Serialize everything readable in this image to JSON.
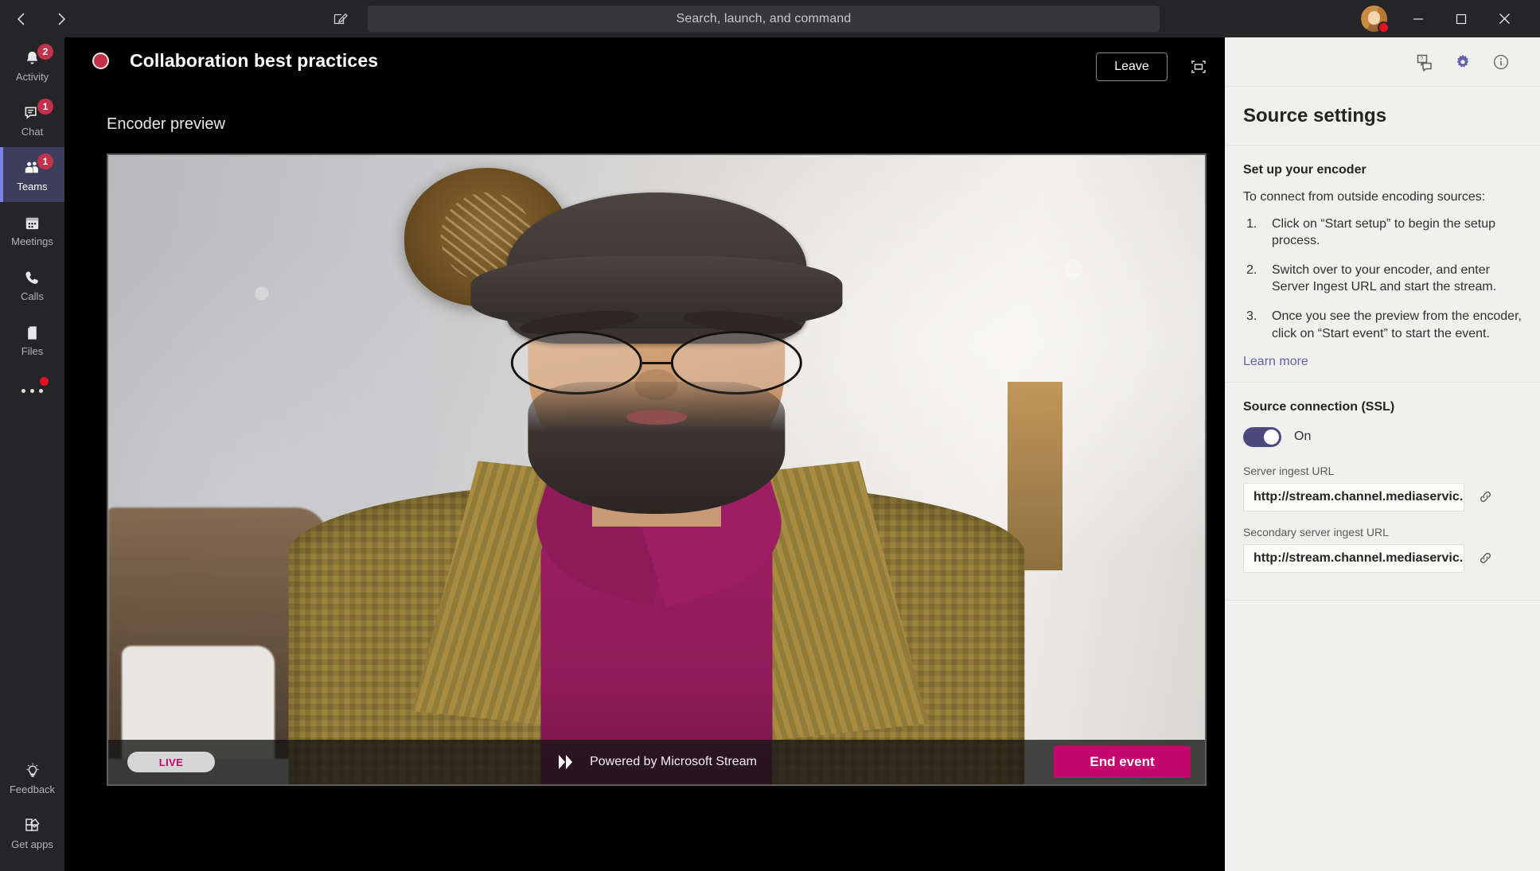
{
  "titlebar": {
    "back_icon": "chevron-left-icon",
    "forward_icon": "chevron-right-icon",
    "compose_icon": "compose-new-chat-icon",
    "search_placeholder": "Search, launch, and command",
    "minimize_label": "—",
    "maximize_label": "□",
    "close_label": "✕"
  },
  "rail": {
    "items": [
      {
        "label": "Activity",
        "icon": "bell-icon",
        "badge": "2",
        "active": false
      },
      {
        "label": "Chat",
        "icon": "chat-icon",
        "badge": "1",
        "active": false
      },
      {
        "label": "Teams",
        "icon": "teams-icon",
        "badge": "1",
        "active": true
      },
      {
        "label": "Meetings",
        "icon": "calendar-icon",
        "badge": "",
        "active": false
      },
      {
        "label": "Calls",
        "icon": "phone-icon",
        "badge": "",
        "active": false
      },
      {
        "label": "Files",
        "icon": "file-icon",
        "badge": "",
        "active": false
      }
    ],
    "more_icon": "more-options-icon",
    "bottom": [
      {
        "label": "Feedback",
        "icon": "lightbulb-icon"
      },
      {
        "label": "Get apps",
        "icon": "get-apps-icon"
      }
    ]
  },
  "stage": {
    "meeting_title": "Collaboration best practices",
    "recording_indicator": "recording-dot-icon",
    "leave_label": "Leave",
    "fullscreen_icon": "fullscreen-icon",
    "encoder_preview_label": "Encoder preview",
    "player": {
      "live_label": "LIVE",
      "powered_by": "Powered by Microsoft Stream",
      "stream_logo_icon": "microsoft-stream-logo-icon",
      "end_event_label": "End event"
    }
  },
  "panel": {
    "toolbar": {
      "qa_icon": "q-and-a-icon",
      "settings_icon": "gear-icon",
      "info_icon": "info-circle-icon"
    },
    "title": "Source settings",
    "encoder": {
      "heading": "Set up your encoder",
      "intro": "To connect from outside encoding sources:",
      "steps": [
        "Click on “Start setup” to begin the setup process.",
        "Switch over to your encoder, and enter Server Ingest URL and start the stream.",
        "Once you see the preview from the encoder, click on “Start event” to start the event."
      ],
      "learn_more": "Learn more"
    },
    "connection": {
      "heading": "Source connection (SSL)",
      "toggle_state": "On",
      "primary_label": "Server ingest URL",
      "primary_value": "http://stream.channel.mediaservic...",
      "secondary_label": "Secondary server ingest URL",
      "secondary_value": "http://stream.channel.mediaservic...",
      "copy_icon": "copy-link-icon"
    }
  },
  "colors": {
    "accent": "#6264a7",
    "rail_active": "#3d3d5c",
    "badge_red": "#c4314b",
    "end_event_pink": "#c4066f",
    "panel_bg": "#f0f0ef"
  }
}
